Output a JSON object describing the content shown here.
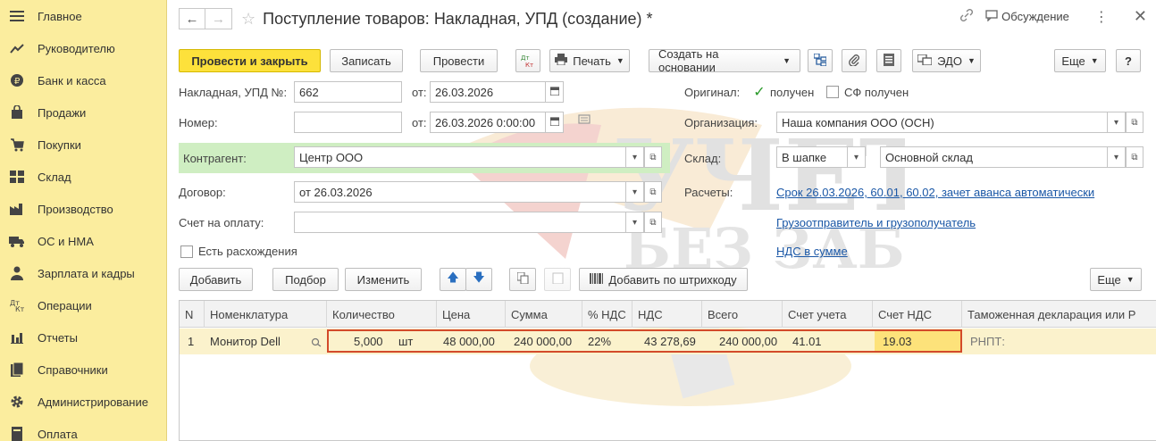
{
  "sidebar": {
    "items": [
      {
        "label": "Главное",
        "icon": "menu-icon"
      },
      {
        "label": "Руководителю",
        "icon": "trend-icon"
      },
      {
        "label": "Банк и касса",
        "icon": "coin-icon"
      },
      {
        "label": "Продажи",
        "icon": "bag-icon"
      },
      {
        "label": "Покупки",
        "icon": "cart-icon"
      },
      {
        "label": "Склад",
        "icon": "warehouse-icon"
      },
      {
        "label": "Производство",
        "icon": "factory-icon"
      },
      {
        "label": "ОС и НМА",
        "icon": "truck-icon"
      },
      {
        "label": "Зарплата и кадры",
        "icon": "person-icon"
      },
      {
        "label": "Операции",
        "icon": "dt-kt-icon"
      },
      {
        "label": "Отчеты",
        "icon": "bar-chart-icon"
      },
      {
        "label": "Справочники",
        "icon": "book-icon"
      },
      {
        "label": "Администрирование",
        "icon": "gear-icon"
      },
      {
        "label": "Оплата",
        "icon": "payment-icon"
      }
    ]
  },
  "header": {
    "title": "Поступление товаров: Накладная, УПД (создание) *",
    "discuss_label": "Обсуждение"
  },
  "toolbar": {
    "post_close": "Провести и закрыть",
    "save": "Записать",
    "post": "Провести",
    "dtkt": "Дт Кт",
    "print": "Печать",
    "create_based": "Создать на основании",
    "edo": "ЭДО",
    "more": "Еще",
    "help": "?"
  },
  "form": {
    "doc_label": "Накладная, УПД №:",
    "doc_number": "662",
    "from_label": "от:",
    "doc_date": "26.03.2026",
    "number_label": "Номер:",
    "number_value": "",
    "date2": "26.03.2026  0:00:00",
    "original_label": "Оригинал:",
    "received_label": "получен",
    "sf_label": "СФ получен",
    "org_label": "Организация:",
    "org_value": "Наша компания ООО (ОСН)",
    "kontragent_label": "Контрагент:",
    "kontragent_value": "Центр ООО",
    "sklad_label": "Склад:",
    "sklad_mode": "В шапке",
    "sklad_value": "Основной склад",
    "dogovor_label": "Договор:",
    "dogovor_value": "от 26.03.2026",
    "raschety_label": "Расчеты:",
    "raschety_link": "Срок 26.03.2026, 60.01, 60.02, зачет аванса автоматически",
    "schet_label": "Счет на оплату:",
    "schet_value": "",
    "gruz_link": "Грузоотправитель и грузополучатель",
    "razhozh_label": "Есть расхождения",
    "nds_link": "НДС в сумме"
  },
  "table_toolbar": {
    "add": "Добавить",
    "pick": "Подбор",
    "change": "Изменить",
    "barcode": "Добавить по штрихкоду",
    "more": "Еще"
  },
  "table": {
    "columns": [
      "N",
      "Номенклатура",
      "Количество",
      "Цена",
      "Сумма",
      "% НДС",
      "НДС",
      "Всего",
      "Счет учета",
      "Счет НДС",
      "Таможенная декларация или Р"
    ],
    "rows": [
      {
        "n": "1",
        "name": "Монитор Dell",
        "qty": "5,000",
        "unit": "шт",
        "price": "48 000,00",
        "sum": "240 000,00",
        "vat_rate": "22%",
        "vat": "43 278,69",
        "total": "240 000,00",
        "account": "41.01",
        "vat_account": "19.03",
        "customs": "РНПТ:"
      }
    ]
  },
  "watermark": {
    "line1": "УЧЕТ",
    "line2": "БЕЗ ЗАБОТ"
  },
  "colors": {
    "sidebar_bg": "#fbed9e",
    "primary_btn": "#fde13b",
    "kontragent_bg": "#cfeec2",
    "row_highlight": "#fbf2cc",
    "link": "#1a57a6",
    "highlight_border": "#d34a2a"
  }
}
